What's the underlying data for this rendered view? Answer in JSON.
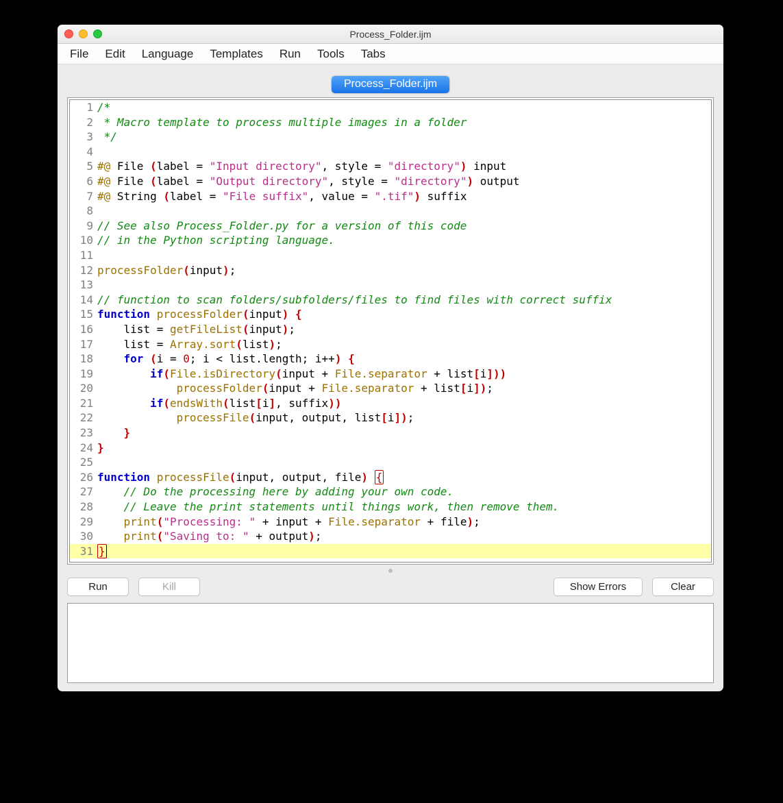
{
  "window": {
    "title": "Process_Folder.ijm"
  },
  "menu": {
    "items": [
      "File",
      "Edit",
      "Language",
      "Templates",
      "Run",
      "Tools",
      "Tabs"
    ]
  },
  "tab": {
    "label": "Process_Folder.ijm"
  },
  "buttons": {
    "run": "Run",
    "kill": "Kill",
    "show_errors": "Show Errors",
    "clear": "Clear"
  },
  "code": {
    "lines": [
      {
        "n": 1,
        "tokens": [
          {
            "t": "/*",
            "c": "c-comment"
          }
        ]
      },
      {
        "n": 2,
        "tokens": [
          {
            "t": " * Macro template to process multiple images in a folder",
            "c": "c-comment"
          }
        ]
      },
      {
        "n": 3,
        "tokens": [
          {
            "t": " */",
            "c": "c-comment"
          }
        ]
      },
      {
        "n": 4,
        "tokens": []
      },
      {
        "n": 5,
        "tokens": [
          {
            "t": "#@",
            "c": "c-dir"
          },
          {
            "t": " File "
          },
          {
            "t": "(",
            "c": "c-paren"
          },
          {
            "t": "label = "
          },
          {
            "t": "\"Input directory\"",
            "c": "c-str"
          },
          {
            "t": ", style = "
          },
          {
            "t": "\"directory\"",
            "c": "c-str"
          },
          {
            "t": ")",
            "c": "c-paren"
          },
          {
            "t": " input"
          }
        ]
      },
      {
        "n": 6,
        "tokens": [
          {
            "t": "#@",
            "c": "c-dir"
          },
          {
            "t": " File "
          },
          {
            "t": "(",
            "c": "c-paren"
          },
          {
            "t": "label = "
          },
          {
            "t": "\"Output directory\"",
            "c": "c-str"
          },
          {
            "t": ", style = "
          },
          {
            "t": "\"directory\"",
            "c": "c-str"
          },
          {
            "t": ")",
            "c": "c-paren"
          },
          {
            "t": " output"
          }
        ]
      },
      {
        "n": 7,
        "tokens": [
          {
            "t": "#@",
            "c": "c-dir"
          },
          {
            "t": " String "
          },
          {
            "t": "(",
            "c": "c-paren"
          },
          {
            "t": "label = "
          },
          {
            "t": "\"File suffix\"",
            "c": "c-str"
          },
          {
            "t": ", value = "
          },
          {
            "t": "\".tif\"",
            "c": "c-str"
          },
          {
            "t": ")",
            "c": "c-paren"
          },
          {
            "t": " suffix"
          }
        ]
      },
      {
        "n": 8,
        "tokens": []
      },
      {
        "n": 9,
        "tokens": [
          {
            "t": "// See also Process_Folder.py for a version of this code",
            "c": "c-comment"
          }
        ]
      },
      {
        "n": 10,
        "tokens": [
          {
            "t": "// in the Python scripting language.",
            "c": "c-comment"
          }
        ]
      },
      {
        "n": 11,
        "tokens": []
      },
      {
        "n": 12,
        "tokens": [
          {
            "t": "processFolder",
            "c": "c-id3"
          },
          {
            "t": "(",
            "c": "c-paren"
          },
          {
            "t": "input"
          },
          {
            "t": ")",
            "c": "c-paren"
          },
          {
            "t": ";"
          }
        ]
      },
      {
        "n": 13,
        "tokens": []
      },
      {
        "n": 14,
        "tokens": [
          {
            "t": "// function to scan folders/subfolders/files to find files with correct suffix",
            "c": "c-comment"
          }
        ]
      },
      {
        "n": 15,
        "tokens": [
          {
            "t": "function",
            "c": "c-kw"
          },
          {
            "t": " "
          },
          {
            "t": "processFolder",
            "c": "c-id3"
          },
          {
            "t": "(",
            "c": "c-paren"
          },
          {
            "t": "input"
          },
          {
            "t": ")",
            "c": "c-paren"
          },
          {
            "t": " "
          },
          {
            "t": "{",
            "c": "c-paren"
          }
        ]
      },
      {
        "n": 16,
        "tokens": [
          {
            "t": "    list = "
          },
          {
            "t": "getFileList",
            "c": "c-id3"
          },
          {
            "t": "(",
            "c": "c-paren"
          },
          {
            "t": "input"
          },
          {
            "t": ")",
            "c": "c-paren"
          },
          {
            "t": ";"
          }
        ]
      },
      {
        "n": 17,
        "tokens": [
          {
            "t": "    list = "
          },
          {
            "t": "Array.sort",
            "c": "c-id3"
          },
          {
            "t": "(",
            "c": "c-paren"
          },
          {
            "t": "list"
          },
          {
            "t": ")",
            "c": "c-paren"
          },
          {
            "t": ";"
          }
        ]
      },
      {
        "n": 18,
        "tokens": [
          {
            "t": "    "
          },
          {
            "t": "for",
            "c": "c-kw"
          },
          {
            "t": " "
          },
          {
            "t": "(",
            "c": "c-paren"
          },
          {
            "t": "i = "
          },
          {
            "t": "0",
            "c": "c-num"
          },
          {
            "t": "; i < list.length; i++"
          },
          {
            "t": ")",
            "c": "c-paren"
          },
          {
            "t": " "
          },
          {
            "t": "{",
            "c": "c-paren"
          }
        ]
      },
      {
        "n": 19,
        "tokens": [
          {
            "t": "        "
          },
          {
            "t": "if",
            "c": "c-kw"
          },
          {
            "t": "(",
            "c": "c-paren"
          },
          {
            "t": "File.isDirectory",
            "c": "c-id3"
          },
          {
            "t": "(",
            "c": "c-paren"
          },
          {
            "t": "input + "
          },
          {
            "t": "File.separator",
            "c": "c-id3"
          },
          {
            "t": " + list"
          },
          {
            "t": "[",
            "c": "c-paren"
          },
          {
            "t": "i"
          },
          {
            "t": "]",
            "c": "c-paren"
          },
          {
            "t": ")",
            "c": "c-paren"
          },
          {
            "t": ")",
            "c": "c-paren"
          }
        ]
      },
      {
        "n": 20,
        "tokens": [
          {
            "t": "            "
          },
          {
            "t": "processFolder",
            "c": "c-id3"
          },
          {
            "t": "(",
            "c": "c-paren"
          },
          {
            "t": "input + "
          },
          {
            "t": "File.separator",
            "c": "c-id3"
          },
          {
            "t": " + list"
          },
          {
            "t": "[",
            "c": "c-paren"
          },
          {
            "t": "i"
          },
          {
            "t": "]",
            "c": "c-paren"
          },
          {
            "t": ")",
            "c": "c-paren"
          },
          {
            "t": ";"
          }
        ]
      },
      {
        "n": 21,
        "tokens": [
          {
            "t": "        "
          },
          {
            "t": "if",
            "c": "c-kw"
          },
          {
            "t": "(",
            "c": "c-paren"
          },
          {
            "t": "endsWith",
            "c": "c-id3"
          },
          {
            "t": "(",
            "c": "c-paren"
          },
          {
            "t": "list"
          },
          {
            "t": "[",
            "c": "c-paren"
          },
          {
            "t": "i"
          },
          {
            "t": "]",
            "c": "c-paren"
          },
          {
            "t": ", suffix"
          },
          {
            "t": ")",
            "c": "c-paren"
          },
          {
            "t": ")",
            "c": "c-paren"
          }
        ]
      },
      {
        "n": 22,
        "tokens": [
          {
            "t": "            "
          },
          {
            "t": "processFile",
            "c": "c-id3"
          },
          {
            "t": "(",
            "c": "c-paren"
          },
          {
            "t": "input, output, list"
          },
          {
            "t": "[",
            "c": "c-paren"
          },
          {
            "t": "i"
          },
          {
            "t": "]",
            "c": "c-paren"
          },
          {
            "t": ")",
            "c": "c-paren"
          },
          {
            "t": ";"
          }
        ]
      },
      {
        "n": 23,
        "tokens": [
          {
            "t": "    "
          },
          {
            "t": "}",
            "c": "c-paren"
          }
        ]
      },
      {
        "n": 24,
        "tokens": [
          {
            "t": "}",
            "c": "c-paren"
          }
        ]
      },
      {
        "n": 25,
        "tokens": []
      },
      {
        "n": 26,
        "tokens": [
          {
            "t": "function",
            "c": "c-kw"
          },
          {
            "t": " "
          },
          {
            "t": "processFile",
            "c": "c-id3"
          },
          {
            "t": "(",
            "c": "c-paren"
          },
          {
            "t": "input, output, file"
          },
          {
            "t": ")",
            "c": "c-paren"
          },
          {
            "t": " "
          },
          {
            "t": "{",
            "c": "c-brace-hl"
          }
        ]
      },
      {
        "n": 27,
        "tokens": [
          {
            "t": "    "
          },
          {
            "t": "// Do the processing here by adding your own code.",
            "c": "c-comment"
          }
        ]
      },
      {
        "n": 28,
        "tokens": [
          {
            "t": "    "
          },
          {
            "t": "// Leave the print statements until things work, then remove them.",
            "c": "c-comment"
          }
        ]
      },
      {
        "n": 29,
        "tokens": [
          {
            "t": "    "
          },
          {
            "t": "print",
            "c": "c-id3"
          },
          {
            "t": "(",
            "c": "c-paren"
          },
          {
            "t": "\"Processing: \"",
            "c": "c-str"
          },
          {
            "t": " + input + "
          },
          {
            "t": "File.separator",
            "c": "c-id3"
          },
          {
            "t": " + file"
          },
          {
            "t": ")",
            "c": "c-paren"
          },
          {
            "t": ";"
          }
        ]
      },
      {
        "n": 30,
        "tokens": [
          {
            "t": "    "
          },
          {
            "t": "print",
            "c": "c-id3"
          },
          {
            "t": "(",
            "c": "c-paren"
          },
          {
            "t": "\"Saving to: \"",
            "c": "c-str"
          },
          {
            "t": " + output"
          },
          {
            "t": ")",
            "c": "c-paren"
          },
          {
            "t": ";"
          }
        ]
      },
      {
        "n": 31,
        "hl": true,
        "cursor": true,
        "tokens": [
          {
            "t": "}",
            "c": "c-brace-hl"
          }
        ]
      }
    ]
  }
}
